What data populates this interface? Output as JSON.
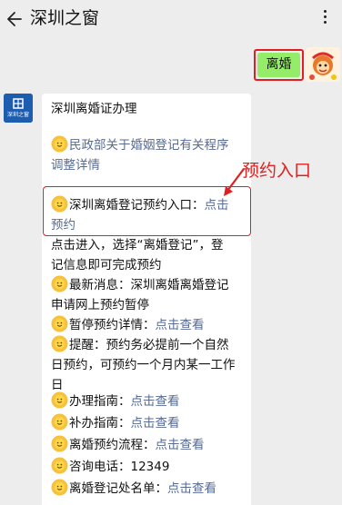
{
  "header": {
    "title": "深圳之窗",
    "back_icon": "back-arrow-icon",
    "menu_icon": "more-icon"
  },
  "outgoing": {
    "text": "离婚",
    "bubble_color": "#95ec69"
  },
  "bot": {
    "avatar_text": "深圳之窗"
  },
  "message": {
    "title": "深圳离婚证办理",
    "items": [
      {
        "line1": "民政部关于婚姻登记有关程序",
        "line2": "调整详情"
      },
      {
        "line1_prefix": "深圳离婚登记预约入口：",
        "line1_link": "点击",
        "line2_link": "预约"
      },
      {
        "line1": "点击进入，选择“离婚登记”，登",
        "line2": "记信息即可完成预约"
      },
      {
        "line1": "最新消息：深圳离婚离婚登记",
        "line2": "申请网上预约暂停"
      },
      {
        "prefix": "暂停预约详情：",
        "link": "点击查看"
      },
      {
        "line1": "提醒：预约务必提前一个自然",
        "line2": "日预约，可预约一个月内某一工作",
        "line3": "日"
      },
      {
        "prefix": "办理指南：",
        "link": "点击查看"
      },
      {
        "prefix": "补办指南：",
        "link": "点击查看"
      },
      {
        "prefix": "离婚预约流程：",
        "link": "点击查看"
      },
      {
        "text": "咨询电话：12349"
      },
      {
        "prefix": "离婚登记处名单：",
        "link": "点击查看"
      }
    ]
  },
  "annotation": {
    "label": "预约入口",
    "color": "#e02020"
  },
  "colors": {
    "link": "#576b95",
    "background": "#ededed"
  }
}
